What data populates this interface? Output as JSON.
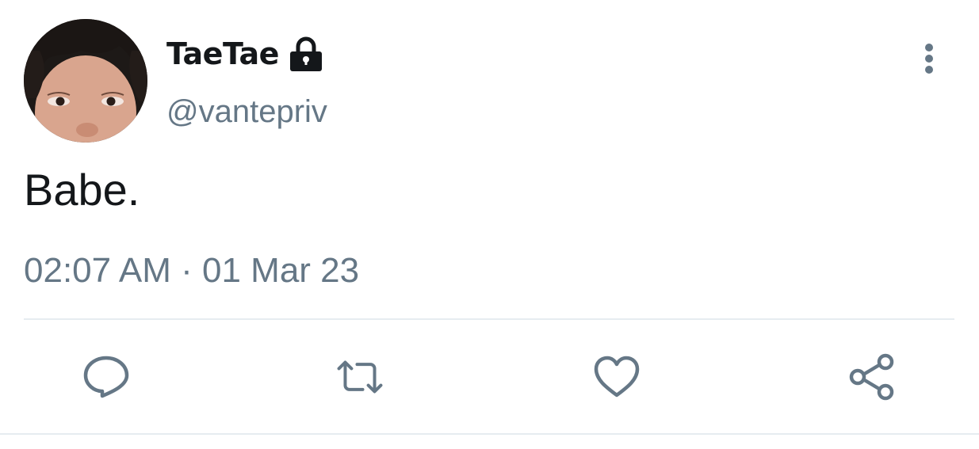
{
  "tweet": {
    "display_name": "TaeTae",
    "handle": "@vantepriv",
    "text": "Babe.",
    "timestamp": "02:07 AM · 01 Mar 23",
    "protected": true
  },
  "icons": {
    "lock": "lock-icon",
    "more": "more-vertical-icon",
    "reply": "reply-icon",
    "retweet": "retweet-icon",
    "like": "heart-icon",
    "share": "share-icon"
  },
  "colors": {
    "name": "#14171a",
    "secondary": "#657786",
    "divider": "#e6ecf0"
  }
}
